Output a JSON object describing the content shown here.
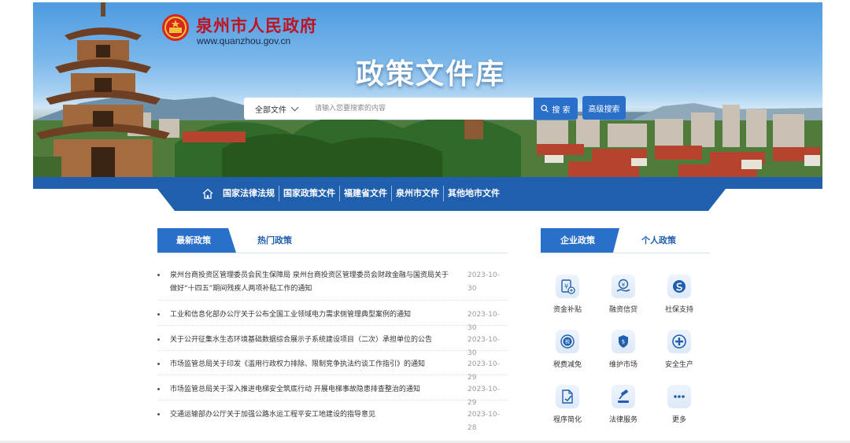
{
  "header": {
    "site_title": "泉州市人民政府",
    "site_url": "www.quanzhou.gov.cn",
    "library_title": "政策文件库"
  },
  "search": {
    "scope_label": "全部文件",
    "placeholder": "请输入您要搜索的内容",
    "search_label": "搜 索",
    "advanced_label": "高级搜索"
  },
  "nav": {
    "items": [
      "国家法律法规",
      "国家政策文件",
      "福建省文件",
      "泉州市文件",
      "其他地市文件"
    ]
  },
  "policy_tabs": {
    "active": "最新政策",
    "other": "热门政策"
  },
  "news": [
    {
      "title": "泉州台商投资区管理委员会民生保障局 泉州台商投资区管理委员会财政金融与国资局关于做好“十四五”期间残疾人两项补贴工作的通知",
      "date": "2023-10-30"
    },
    {
      "title": "工业和信息化部办公厅关于公布全国工业领域电力需求侧管理典型案例的通知",
      "date": "2023-10-30"
    },
    {
      "title": "关于公开征集水生态环境基础数据综合展示子系统建设项目（二次）承担单位的公告",
      "date": "2023-10-30"
    },
    {
      "title": "市场监管总局关于印发《滥用行政权力排除、限制竞争执法约谈工作指引》的通知",
      "date": "2023-10-29"
    },
    {
      "title": "市场监管总局关于深入推进电梯安全筑底行动 开展电梯事故隐患排查整治的通知",
      "date": "2023-10-29"
    },
    {
      "title": "交通运输部办公厅关于加强公路水运工程平安工地建设的指导意见",
      "date": "2023-10-28"
    }
  ],
  "service_tabs": {
    "active": "企业政策",
    "other": "个人政策"
  },
  "services": [
    {
      "label": "资金补贴",
      "icon": "subsidy-icon"
    },
    {
      "label": "融资信贷",
      "icon": "finance-icon"
    },
    {
      "label": "社保支持",
      "icon": "social-security-icon"
    },
    {
      "label": "税费减免",
      "icon": "tax-icon"
    },
    {
      "label": "维护市场",
      "icon": "market-icon"
    },
    {
      "label": "安全生产",
      "icon": "safety-icon"
    },
    {
      "label": "程序简化",
      "icon": "procedure-icon"
    },
    {
      "label": "法律服务",
      "icon": "legal-icon"
    },
    {
      "label": "更多",
      "icon": "more-icon"
    }
  ],
  "colors": {
    "brand_red": "#c1121f",
    "brand_blue": "#1f5fae",
    "accent_blue": "#2a6fc9"
  }
}
